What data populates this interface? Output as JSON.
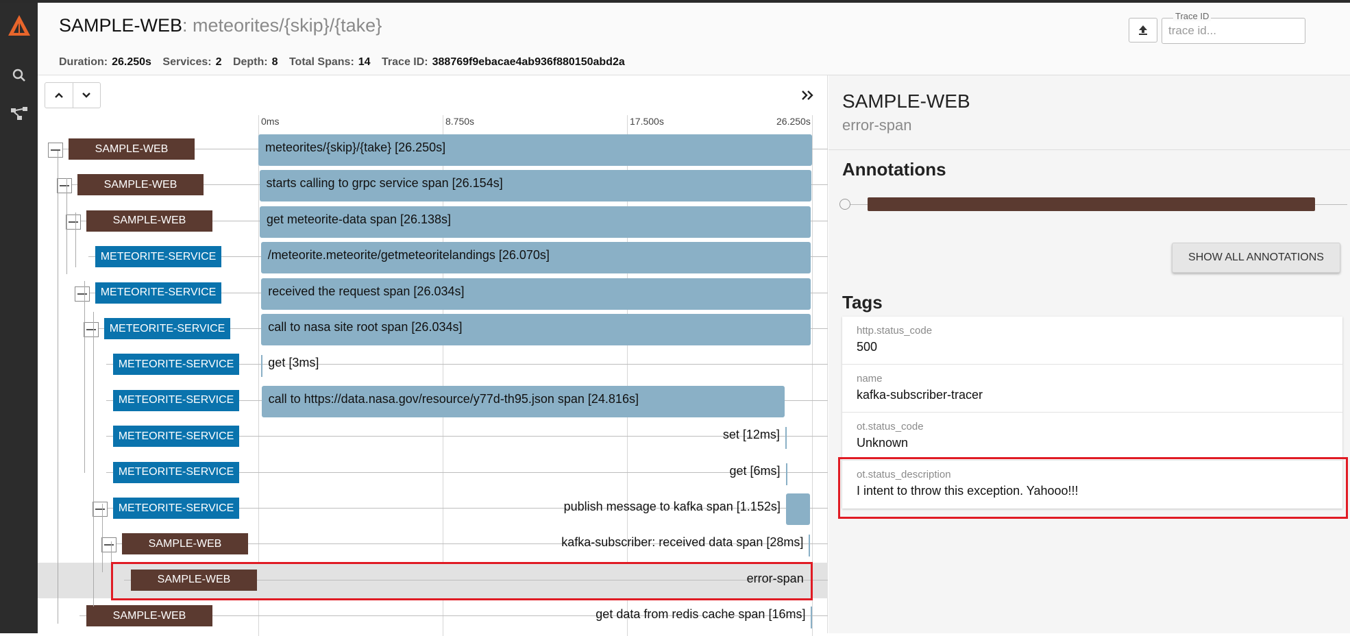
{
  "header": {
    "service": "SAMPLE-WEB",
    "operation": ": meteorites/{skip}/{take}",
    "stats": [
      {
        "label": "Duration:",
        "value": "26.250s"
      },
      {
        "label": "Services:",
        "value": "2"
      },
      {
        "label": "Depth:",
        "value": "8"
      },
      {
        "label": "Total Spans:",
        "value": "14"
      },
      {
        "label": "Trace ID:",
        "value": "388769f9ebacae4ab936f880150abd2a"
      }
    ],
    "trace_id_label": "Trace ID",
    "trace_id_placeholder": "trace id..."
  },
  "nav": {
    "icons": [
      "logo-icon",
      "search-icon",
      "dependencies-icon"
    ]
  },
  "timeline": {
    "ticks": [
      "0ms",
      "8.750s",
      "17.500s",
      "26.250s"
    ],
    "spans": [
      {
        "service": "SAMPLE-WEB",
        "kind": "web",
        "depth": 0,
        "label": "meteorites/{skip}/{take} [26.250s]",
        "start_s": 0,
        "duration_s": 26.25,
        "collapsible": true
      },
      {
        "service": "SAMPLE-WEB",
        "kind": "web",
        "depth": 1,
        "label": "starts calling to grpc service span [26.154s]",
        "start_s": 0.05,
        "duration_s": 26.154,
        "collapsible": true
      },
      {
        "service": "SAMPLE-WEB",
        "kind": "web",
        "depth": 2,
        "label": "get meteorite-data span [26.138s]",
        "start_s": 0.06,
        "duration_s": 26.138,
        "collapsible": true
      },
      {
        "service": "METEORITE-SERVICE",
        "kind": "met",
        "depth": 3,
        "label": "/meteorite.meteorite/getmeteoritelandings [26.070s]",
        "start_s": 0.12,
        "duration_s": 26.07,
        "collapsible": false
      },
      {
        "service": "METEORITE-SERVICE",
        "kind": "met",
        "depth": 3,
        "label": "received the request span [26.034s]",
        "start_s": 0.14,
        "duration_s": 26.034,
        "collapsible": true
      },
      {
        "service": "METEORITE-SERVICE",
        "kind": "met",
        "depth": 4,
        "label": "call to nasa site root span [26.034s]",
        "start_s": 0.14,
        "duration_s": 26.034,
        "collapsible": true
      },
      {
        "service": "METEORITE-SERVICE",
        "kind": "met",
        "depth": 5,
        "label": "get [3ms]",
        "start_s": 0.14,
        "duration_s": 0.003,
        "collapsible": false
      },
      {
        "service": "METEORITE-SERVICE",
        "kind": "met",
        "depth": 5,
        "label": "call to https://data.nasa.gov/resource/y77d-th95.json span [24.816s]",
        "start_s": 0.15,
        "duration_s": 24.816,
        "collapsible": false
      },
      {
        "service": "METEORITE-SERVICE",
        "kind": "met",
        "depth": 5,
        "label": "set [12ms]",
        "start_s": 24.98,
        "duration_s": 0.012,
        "collapsible": false
      },
      {
        "service": "METEORITE-SERVICE",
        "kind": "met",
        "depth": 5,
        "label": "get [6ms]",
        "start_s": 25.0,
        "duration_s": 0.006,
        "collapsible": false
      },
      {
        "service": "METEORITE-SERVICE",
        "kind": "met",
        "depth": 5,
        "label": "publish message to kafka span [1.152s]",
        "start_s": 25.01,
        "duration_s": 1.152,
        "collapsible": true
      },
      {
        "service": "SAMPLE-WEB",
        "kind": "web",
        "depth": 6,
        "label": "kafka-subscriber: received data span [28ms]",
        "start_s": 26.1,
        "duration_s": 0.028,
        "collapsible": true
      },
      {
        "service": "SAMPLE-WEB",
        "kind": "web",
        "depth": 7,
        "label": "error-span",
        "start_s": 26.11,
        "duration_s": 0.0,
        "collapsible": false,
        "selected": true
      },
      {
        "service": "SAMPLE-WEB",
        "kind": "web",
        "depth": 2,
        "label": "get data from redis cache span [16ms]",
        "start_s": 26.2,
        "duration_s": 0.016,
        "collapsible": false
      }
    ]
  },
  "detail": {
    "service": "SAMPLE-WEB",
    "span_name": "error-span",
    "annotations_heading": "Annotations",
    "show_all_label": "SHOW ALL ANNOTATIONS",
    "tags_heading": "Tags",
    "tags": [
      {
        "key": "http.status_code",
        "value": "500"
      },
      {
        "key": "name",
        "value": "kafka-subscriber-tracer"
      },
      {
        "key": "ot.status_code",
        "value": "Unknown"
      },
      {
        "key": "ot.status_description",
        "value": "I intent to throw this exception. Yahooo!!!"
      }
    ]
  },
  "colors": {
    "web_service": "#5b3a30",
    "meteorite_service": "#0a73ad",
    "span_bar": "#8ab0c6",
    "highlight": "#e01b24"
  }
}
